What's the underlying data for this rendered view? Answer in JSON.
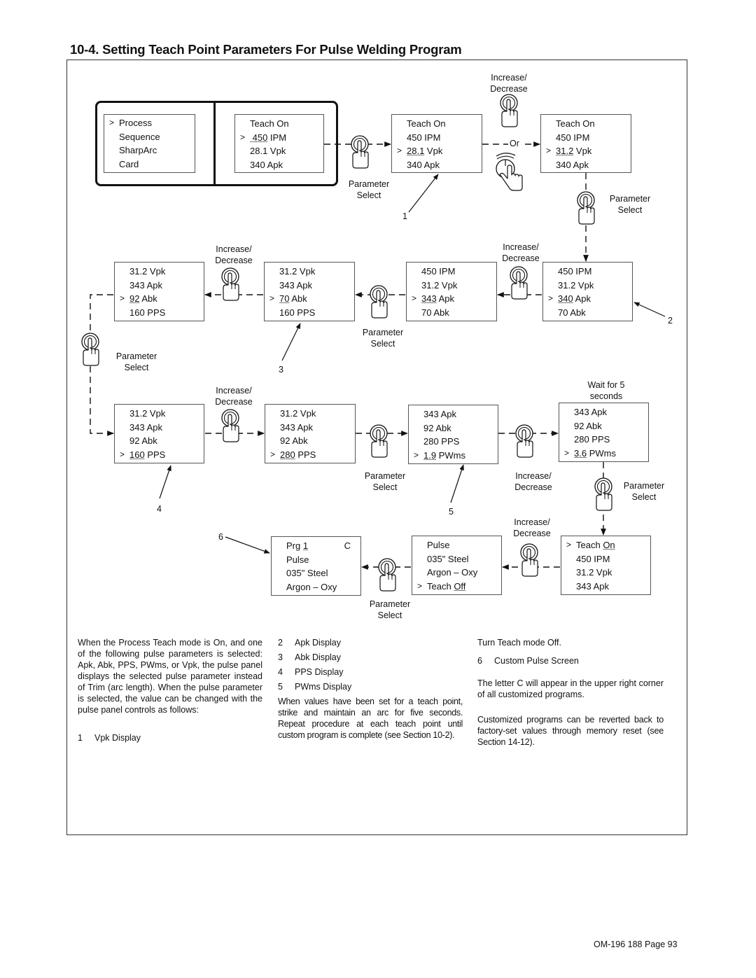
{
  "page": {
    "title": "10-4.  Setting Teach Point Parameters For Pulse Welding Program",
    "footer": "OM-196 188 Page 93"
  },
  "labels": {
    "increase_decrease": [
      "Increase/",
      "Decrease"
    ],
    "parameter_select": [
      "Parameter",
      "Select"
    ],
    "wait": [
      "Wait for 5",
      "seconds"
    ],
    "or": "Or"
  },
  "screens": {
    "menu": [
      {
        "caret": ">",
        "text": "Process"
      },
      {
        "caret": "",
        "text": "Sequence"
      },
      {
        "caret": "",
        "text": "SharpArc"
      },
      {
        "caret": "",
        "text": "Card"
      }
    ],
    "s1": [
      {
        "caret": "",
        "pre": "Teach On",
        "u": "",
        "post": ""
      },
      {
        "caret": ">",
        "pre": "",
        "u": " 450",
        "post": " IPM"
      },
      {
        "caret": "",
        "pre": "28.1 Vpk",
        "u": "",
        "post": ""
      },
      {
        "caret": "",
        "pre": "340 Apk",
        "u": "",
        "post": ""
      }
    ],
    "s2": [
      {
        "caret": "",
        "pre": "Teach On",
        "u": "",
        "post": ""
      },
      {
        "caret": "",
        "pre": "450 IPM",
        "u": "",
        "post": ""
      },
      {
        "caret": ">",
        "pre": "",
        "u": "28.1",
        "post": " Vpk"
      },
      {
        "caret": "",
        "pre": "340 Apk",
        "u": "",
        "post": ""
      }
    ],
    "s3": [
      {
        "caret": "",
        "pre": "Teach On",
        "u": "",
        "post": ""
      },
      {
        "caret": "",
        "pre": "450 IPM",
        "u": "",
        "post": ""
      },
      {
        "caret": ">",
        "pre": "",
        "u": "31.2",
        "post": " Vpk"
      },
      {
        "caret": "",
        "pre": "340 Apk",
        "u": "",
        "post": ""
      }
    ],
    "s4": [
      {
        "caret": "",
        "pre": "450 IPM",
        "u": "",
        "post": ""
      },
      {
        "caret": "",
        "pre": "31.2 Vpk",
        "u": "",
        "post": ""
      },
      {
        "caret": ">",
        "pre": "",
        "u": "340",
        "post": " Apk"
      },
      {
        "caret": "",
        "pre": "70 Abk",
        "u": "",
        "post": ""
      }
    ],
    "s5": [
      {
        "caret": "",
        "pre": "450 IPM",
        "u": "",
        "post": ""
      },
      {
        "caret": "",
        "pre": "31.2 Vpk",
        "u": "",
        "post": ""
      },
      {
        "caret": ">",
        "pre": "",
        "u": "343",
        "post": " Apk"
      },
      {
        "caret": "",
        "pre": "70 Abk",
        "u": "",
        "post": ""
      }
    ],
    "s6": [
      {
        "caret": "",
        "pre": "31.2 Vpk",
        "u": "",
        "post": ""
      },
      {
        "caret": "",
        "pre": "343 Apk",
        "u": "",
        "post": ""
      },
      {
        "caret": ">",
        "pre": "",
        "u": "70",
        "post": " Abk"
      },
      {
        "caret": "",
        "pre": "160 PPS",
        "u": "",
        "post": ""
      }
    ],
    "s7": [
      {
        "caret": "",
        "pre": "31.2 Vpk",
        "u": "",
        "post": ""
      },
      {
        "caret": "",
        "pre": "343 Apk",
        "u": "",
        "post": ""
      },
      {
        "caret": ">",
        "pre": "",
        "u": "92",
        "post": " Abk"
      },
      {
        "caret": "",
        "pre": "160 PPS",
        "u": "",
        "post": ""
      }
    ],
    "s8": [
      {
        "caret": "",
        "pre": "31.2 Vpk",
        "u": "",
        "post": ""
      },
      {
        "caret": "",
        "pre": "343 Apk",
        "u": "",
        "post": ""
      },
      {
        "caret": "",
        "pre": "92 Abk",
        "u": "",
        "post": ""
      },
      {
        "caret": ">",
        "pre": "",
        "u": "160",
        "post": " PPS"
      }
    ],
    "s9": [
      {
        "caret": "",
        "pre": "31.2 Vpk",
        "u": "",
        "post": ""
      },
      {
        "caret": "",
        "pre": "343 Apk",
        "u": "",
        "post": ""
      },
      {
        "caret": "",
        "pre": "92 Abk",
        "u": "",
        "post": ""
      },
      {
        "caret": ">",
        "pre": "",
        "u": "280",
        "post": " PPS"
      }
    ],
    "s10": [
      {
        "caret": "",
        "pre": "343 Apk",
        "u": "",
        "post": ""
      },
      {
        "caret": "",
        "pre": "92 Abk",
        "u": "",
        "post": ""
      },
      {
        "caret": "",
        "pre": "280 PPS",
        "u": "",
        "post": ""
      },
      {
        "caret": ">",
        "pre": "",
        "u": "1.9",
        "post": " PWms"
      }
    ],
    "s11": [
      {
        "caret": "",
        "pre": "343 Apk",
        "u": "",
        "post": ""
      },
      {
        "caret": "",
        "pre": "92 Abk",
        "u": "",
        "post": ""
      },
      {
        "caret": "",
        "pre": "280 PPS",
        "u": "",
        "post": ""
      },
      {
        "caret": ">",
        "pre": "",
        "u": "3.6",
        "post": " PWms"
      }
    ],
    "s12": [
      {
        "caret": ">",
        "pre": "Teach ",
        "u": "On",
        "post": ""
      },
      {
        "caret": "",
        "pre": "450 IPM",
        "u": "",
        "post": ""
      },
      {
        "caret": "",
        "pre": "31.2 Vpk",
        "u": "",
        "post": ""
      },
      {
        "caret": "",
        "pre": "343 Apk",
        "u": "",
        "post": ""
      }
    ],
    "s13": [
      {
        "caret": "",
        "pre": "Pulse",
        "u": "",
        "post": ""
      },
      {
        "caret": "",
        "pre": "035\" Steel",
        "u": "",
        "post": ""
      },
      {
        "caret": "",
        "pre": "Argon – Oxy",
        "u": "",
        "post": ""
      },
      {
        "caret": ">",
        "pre": "Teach ",
        "u": "Off",
        "post": ""
      }
    ],
    "s14": [
      {
        "caret": "",
        "pre": "Prg ",
        "u": "1",
        "post": "",
        "right": "C"
      },
      {
        "caret": "",
        "pre": "Pulse",
        "u": "",
        "post": ""
      },
      {
        "caret": "",
        "pre": "035\" Steel",
        "u": "",
        "post": ""
      },
      {
        "caret": "",
        "pre": "Argon – Oxy",
        "u": "",
        "post": ""
      }
    ]
  },
  "callouts": [
    "1",
    "2",
    "3",
    "4",
    "5",
    "6"
  ],
  "text": {
    "col1_para": "When the Process Teach mode is On, and one of the following pulse parameters is selected: Apk, Abk, PPS, PWms, or Vpk, the pulse panel displays the selected pulse parameter instead of Trim (arc length). When the pulse parameter is selected, the value can be changed with the pulse panel controls as follows:",
    "items": [
      {
        "n": "1",
        "label": "Vpk Display"
      },
      {
        "n": "2",
        "label": "Apk Display"
      },
      {
        "n": "3",
        "label": "Abk Display"
      },
      {
        "n": "4",
        "label": "PPS Display"
      },
      {
        "n": "5",
        "label": "PWms Display"
      },
      {
        "n": "6",
        "label": "Custom Pulse Screen"
      }
    ],
    "col2_para": "When values have been set for a teach point, strike and maintain an arc for five seconds. Repeat procedure at each teach point until custom program is complete (see Section 10-2).",
    "col3_turn_off": "Turn Teach mode Off.",
    "col3_para1": "The letter C will appear in the upper right corner of all customized programs.",
    "col3_para2": "Customized programs can be reverted back to factory-set values through memory reset (see Section 14-12)."
  }
}
